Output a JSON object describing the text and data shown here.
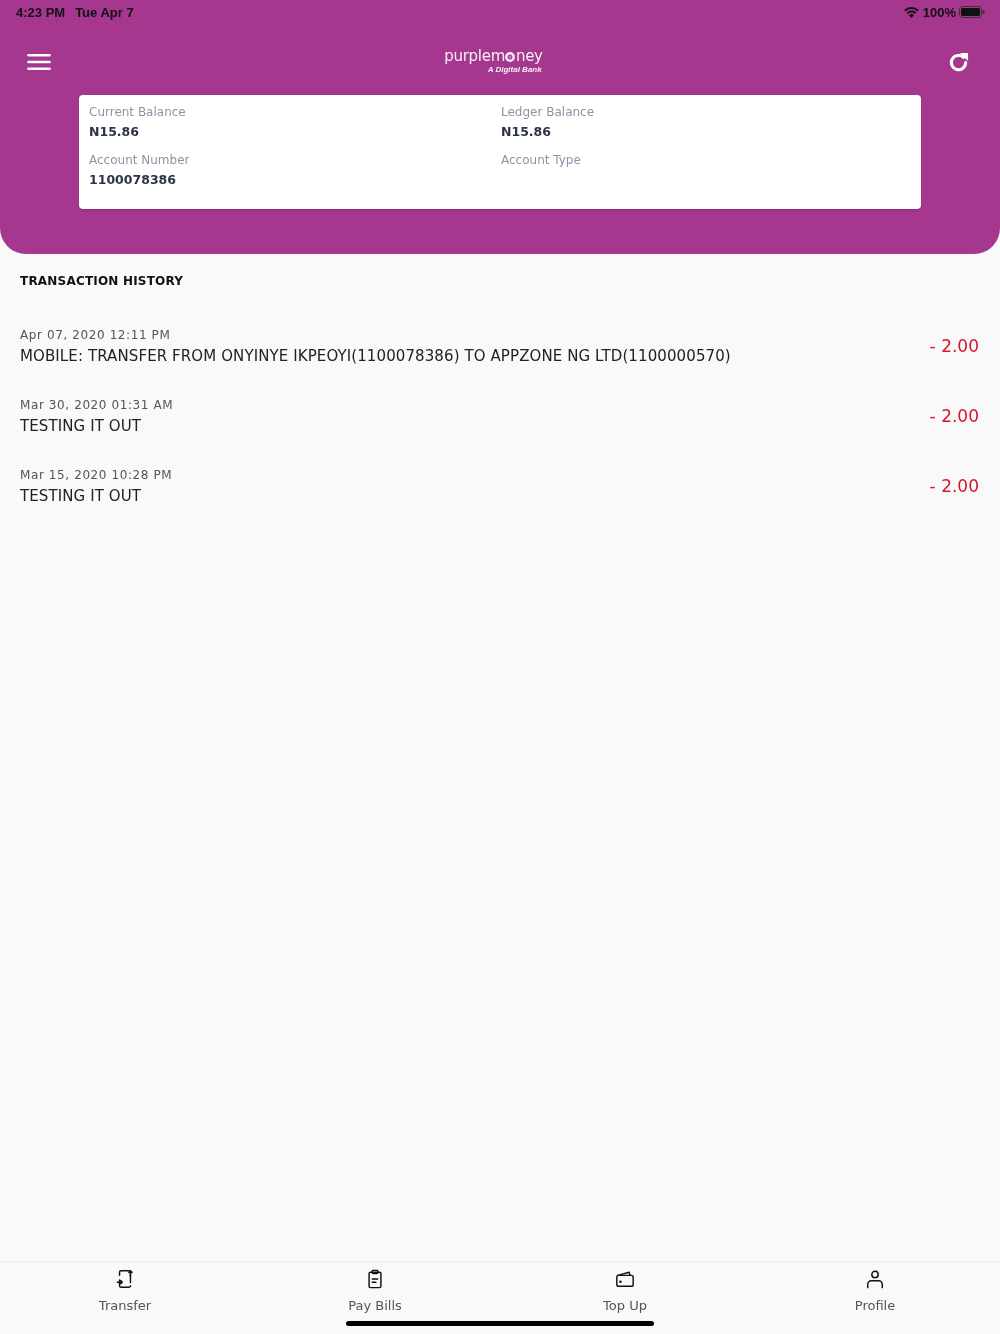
{
  "status_bar": {
    "time": "4:23 PM",
    "date": "Tue Apr 7",
    "battery": "100%"
  },
  "header": {
    "logo": {
      "name_start": "purplem",
      "name_end": "ney",
      "tagline": "A Digital Bank"
    }
  },
  "account_card": {
    "fields": [
      {
        "label": "Current Balance",
        "value": "N15.86"
      },
      {
        "label": "Ledger Balance",
        "value": "N15.86"
      },
      {
        "label": "Account Number",
        "value": "1100078386"
      },
      {
        "label": "Account Type"
      }
    ]
  },
  "transaction_history": {
    "title": "TRANSACTION HISTORY",
    "rows": [
      {
        "date": "Apr 07, 2020 12:11 PM",
        "description": "MOBILE: TRANSFER FROM ONYINYE IKPEOYI(1100078386) TO APPZONE NG LTD(1100000570)",
        "amount": "- 2.00"
      },
      {
        "date": "Mar 30, 2020 01:31 AM",
        "description": "TESTING IT OUT",
        "amount": "- 2.00"
      },
      {
        "date": "Mar 15, 2020 10:28 PM",
        "description": "TESTING IT OUT",
        "amount": "- 2.00"
      }
    ]
  },
  "tab_bar": {
    "items": [
      {
        "kind": "transfer",
        "label": "Transfer"
      },
      {
        "kind": "bills",
        "label": "Pay Bills"
      },
      {
        "kind": "topup",
        "label": "Top Up"
      },
      {
        "kind": "profile",
        "label": "Profile"
      }
    ]
  }
}
